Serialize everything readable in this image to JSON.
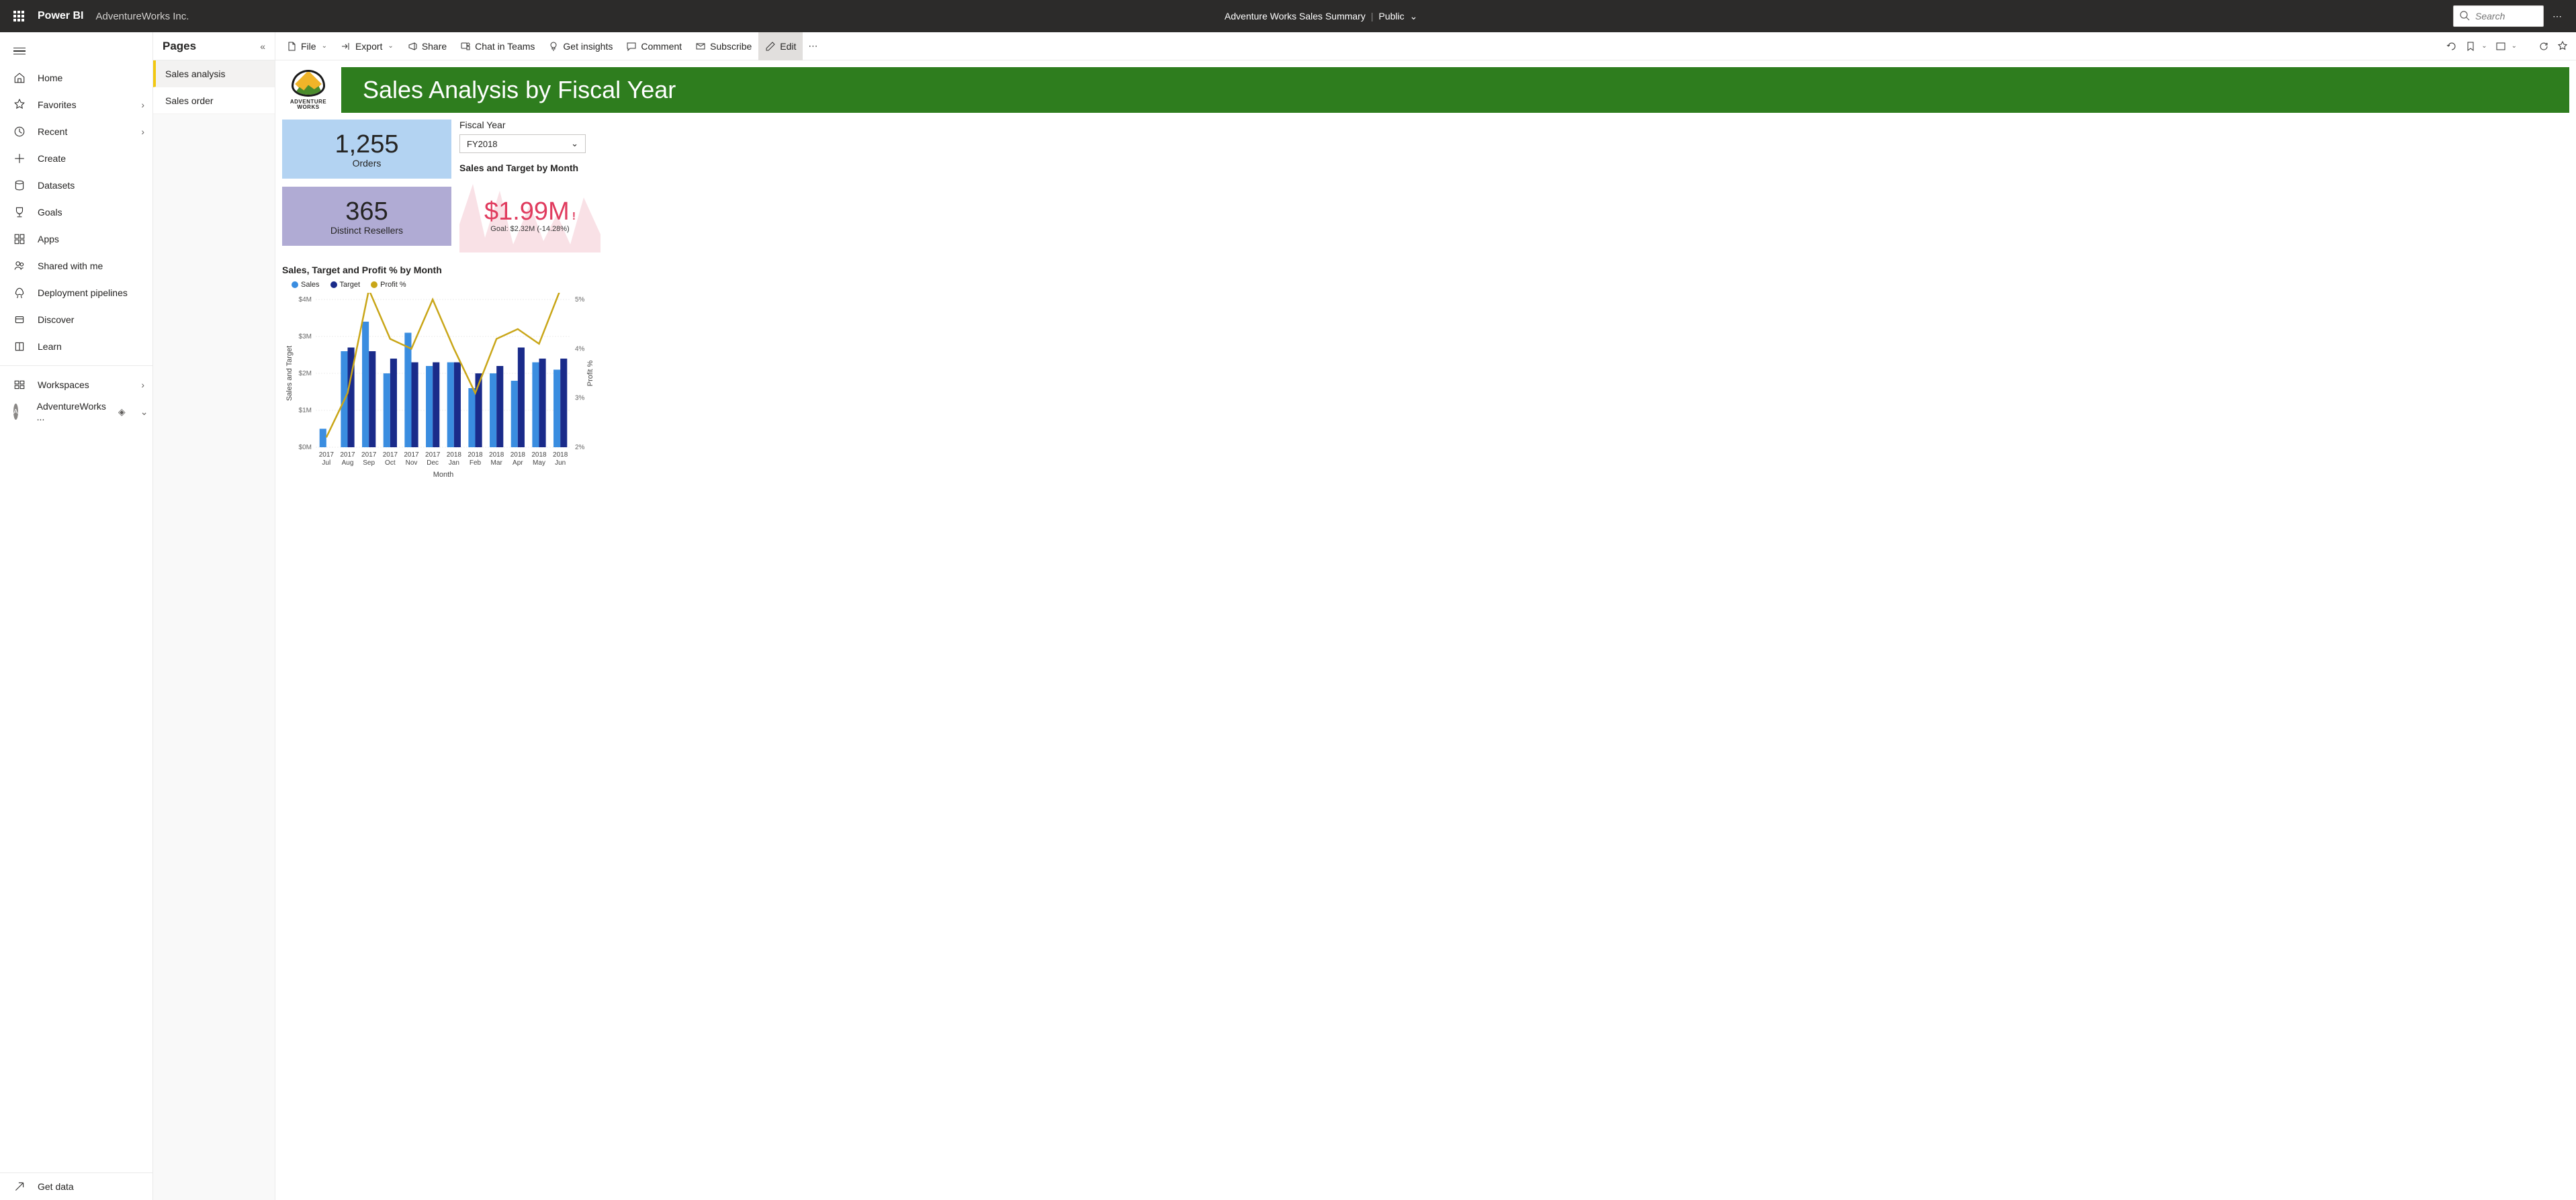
{
  "header": {
    "brand": "Power BI",
    "workspace": "AdventureWorks Inc.",
    "report_title": "Adventure Works Sales Summary",
    "sensitivity": "Public",
    "search_placeholder": "Search"
  },
  "nav": {
    "items": [
      {
        "label": "Home",
        "icon": "home"
      },
      {
        "label": "Favorites",
        "icon": "star",
        "chevron": true
      },
      {
        "label": "Recent",
        "icon": "clock",
        "chevron": true
      },
      {
        "label": "Create",
        "icon": "plus"
      },
      {
        "label": "Datasets",
        "icon": "cylinder"
      },
      {
        "label": "Goals",
        "icon": "trophy"
      },
      {
        "label": "Apps",
        "icon": "grid"
      },
      {
        "label": "Shared with me",
        "icon": "people"
      },
      {
        "label": "Deployment pipelines",
        "icon": "rocket"
      },
      {
        "label": "Discover",
        "icon": "compass"
      },
      {
        "label": "Learn",
        "icon": "book"
      }
    ],
    "workspaces_label": "Workspaces",
    "current_ws": "AdventureWorks ...",
    "get_data": "Get data"
  },
  "pages": {
    "title": "Pages",
    "items": [
      {
        "label": "Sales analysis",
        "active": true
      },
      {
        "label": "Sales order",
        "active": false
      }
    ]
  },
  "toolbar": {
    "file": "File",
    "export": "Export",
    "share": "Share",
    "chat": "Chat in Teams",
    "insights": "Get insights",
    "comment": "Comment",
    "subscribe": "Subscribe",
    "edit": "Edit"
  },
  "report": {
    "logo_top": "ADVENTURE",
    "logo_bottom": "WORKS",
    "title": "Sales Analysis by Fiscal Year",
    "kpi_orders_value": "1,255",
    "kpi_orders_label": "Orders",
    "kpi_resellers_value": "365",
    "kpi_resellers_label": "Distinct Resellers",
    "fy_label": "Fiscal Year",
    "fy_value": "FY2018",
    "sales_target_title": "Sales and Target by Month",
    "sales_value": "$1.99M",
    "sales_bang": "!",
    "goal_text": "Goal: $2.32M (-14.28%)",
    "chart_title": "Sales, Target and Profit % by Month",
    "legend_sales": "Sales",
    "legend_target": "Target",
    "legend_profit": "Profit %",
    "y_axis_label": "Sales and Target",
    "y2_axis_label": "Profit %",
    "x_axis_label": "Month"
  },
  "chart_data": {
    "type": "bar",
    "categories_year": [
      "2017",
      "2017",
      "2017",
      "2017",
      "2017",
      "2017",
      "2018",
      "2018",
      "2018",
      "2018",
      "2018",
      "2018"
    ],
    "categories_month": [
      "Jul",
      "Aug",
      "Sep",
      "Oct",
      "Nov",
      "Dec",
      "Jan",
      "Feb",
      "Mar",
      "Apr",
      "May",
      "Jun"
    ],
    "series": [
      {
        "name": "Sales",
        "color": "#3a8de0",
        "values": [
          0.5,
          2.6,
          3.4,
          2.0,
          3.1,
          2.2,
          2.3,
          1.6,
          2.0,
          1.8,
          2.3,
          2.1
        ]
      },
      {
        "name": "Target",
        "color": "#1a2b8a",
        "values": [
          null,
          2.7,
          2.6,
          2.4,
          2.3,
          2.3,
          2.3,
          2.0,
          2.2,
          2.7,
          2.4,
          2.4
        ]
      }
    ],
    "profit_line": {
      "name": "Profit %",
      "color": "#c9a618",
      "values": [
        2.2,
        3.1,
        5.2,
        4.2,
        4.0,
        5.0,
        4.0,
        3.1,
        4.2,
        4.4,
        4.1,
        5.2
      ]
    },
    "ylim": [
      0,
      4
    ],
    "y2lim": [
      2,
      5
    ],
    "y_ticks": [
      "$0M",
      "$1M",
      "$2M",
      "$3M",
      "$4M"
    ],
    "y2_ticks": [
      "2%",
      "3%",
      "4%",
      "5%"
    ],
    "ylabel": "Sales and Target",
    "y2label": "Profit %",
    "xlabel": "Month"
  }
}
